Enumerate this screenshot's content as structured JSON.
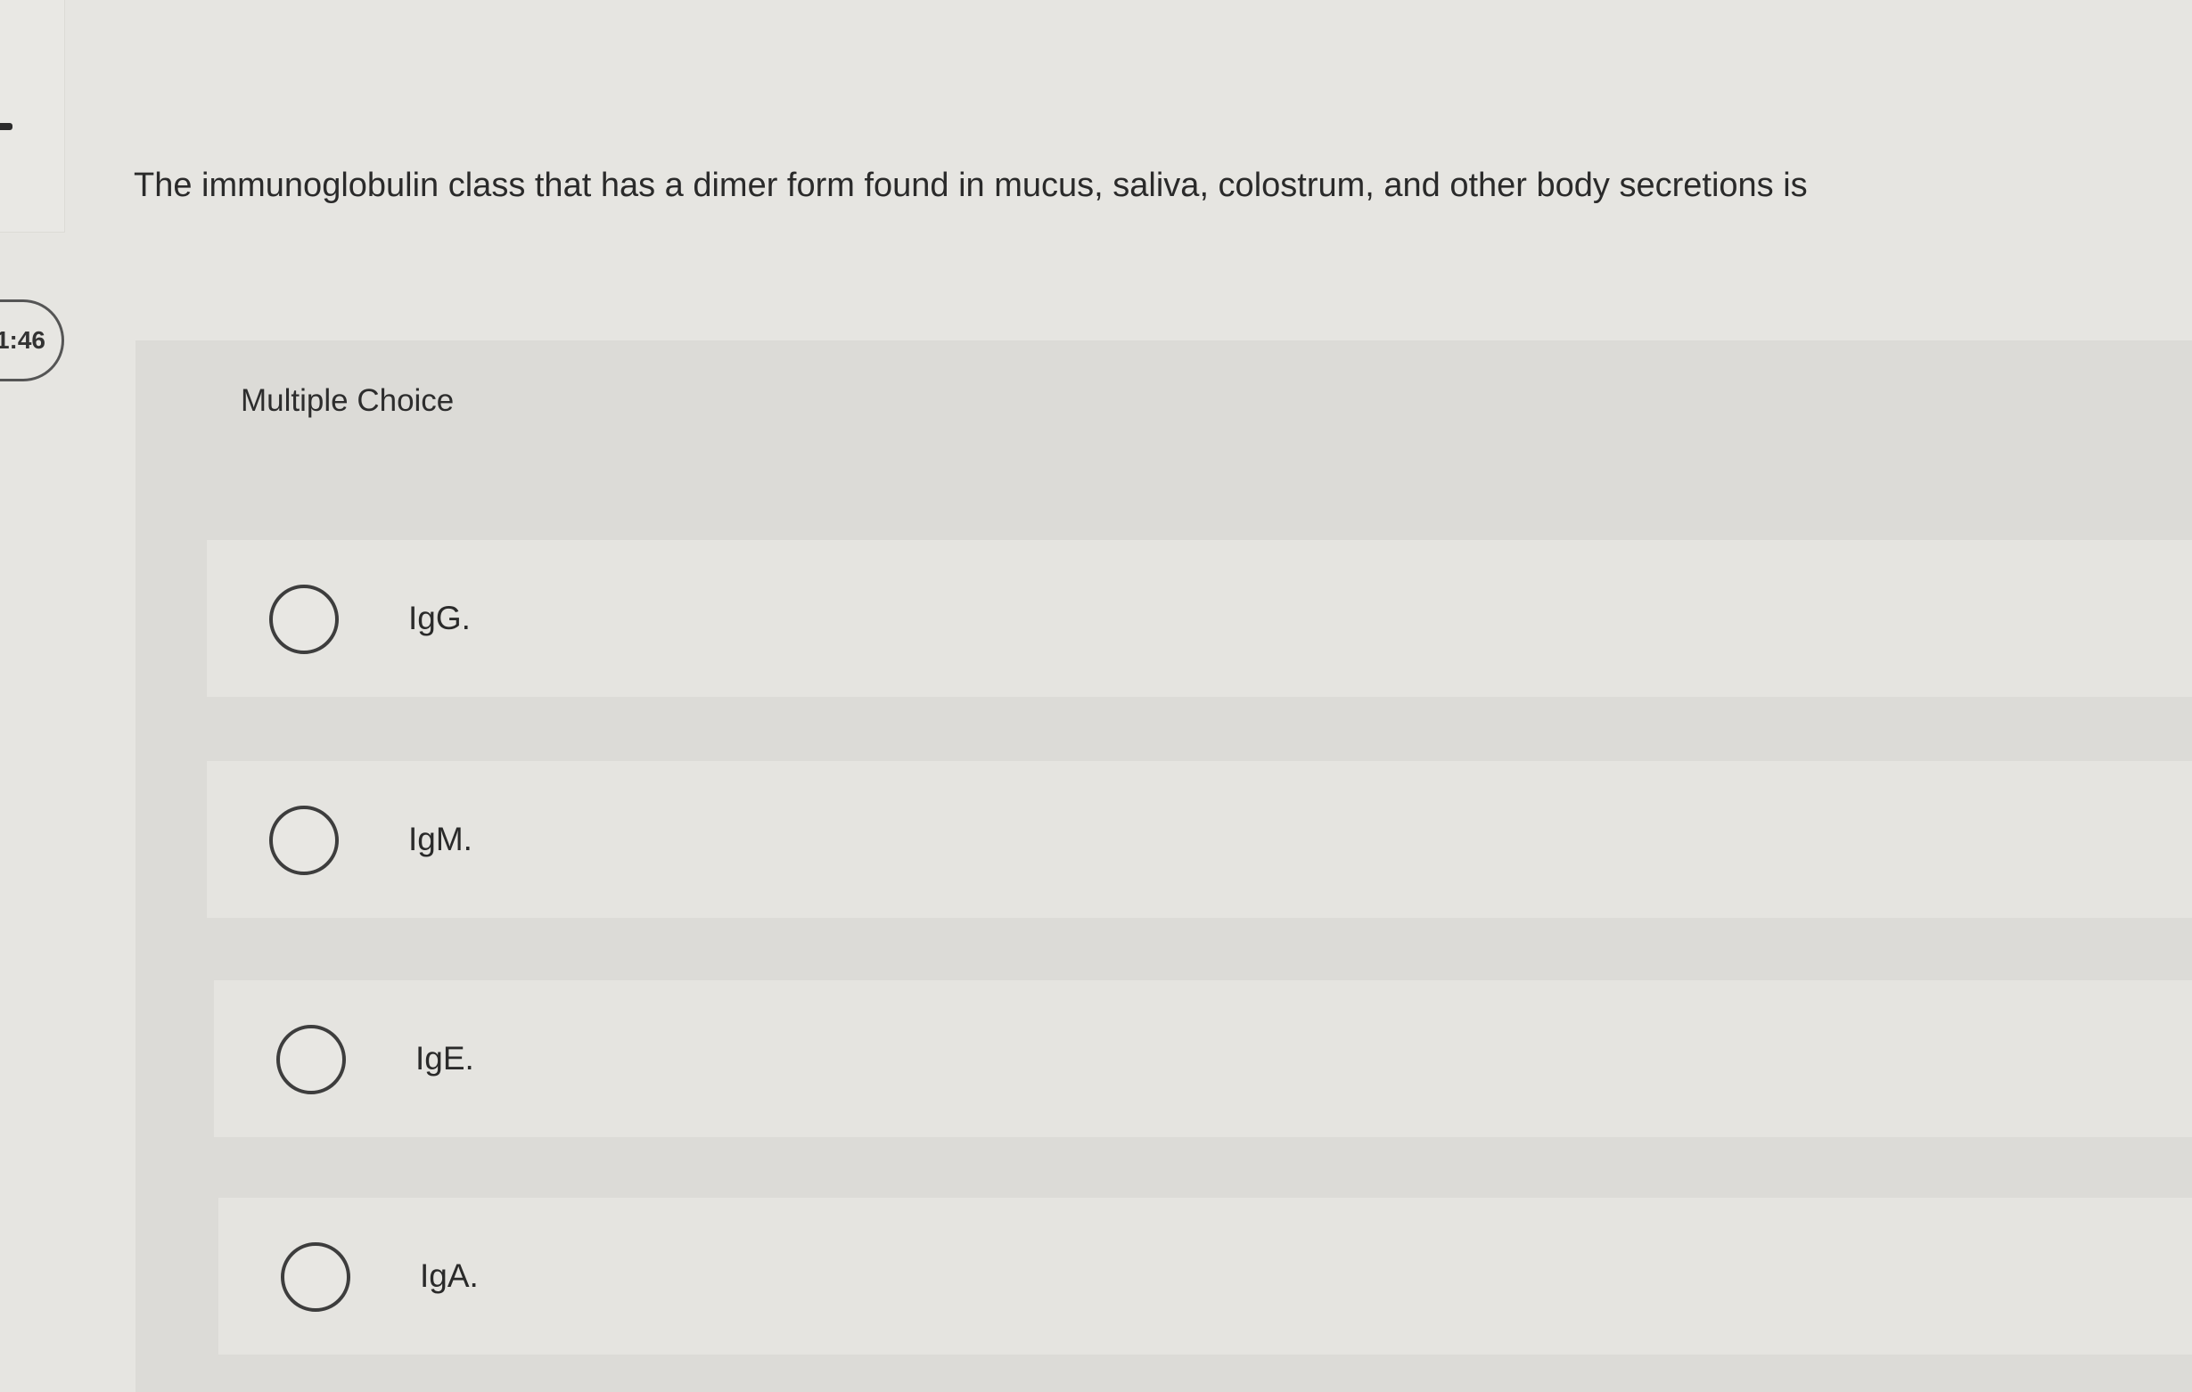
{
  "timer": {
    "text": "1:46"
  },
  "question": {
    "text": "The immunoglobulin class that has a dimer form found in mucus, saliva, colostrum, and other body secretions is"
  },
  "answer_section": {
    "type_label": "Multiple Choice",
    "choices": [
      {
        "label": "IgG.",
        "selected": false
      },
      {
        "label": "IgM.",
        "selected": false
      },
      {
        "label": "IgE.",
        "selected": false
      },
      {
        "label": "IgA.",
        "selected": false
      }
    ]
  }
}
